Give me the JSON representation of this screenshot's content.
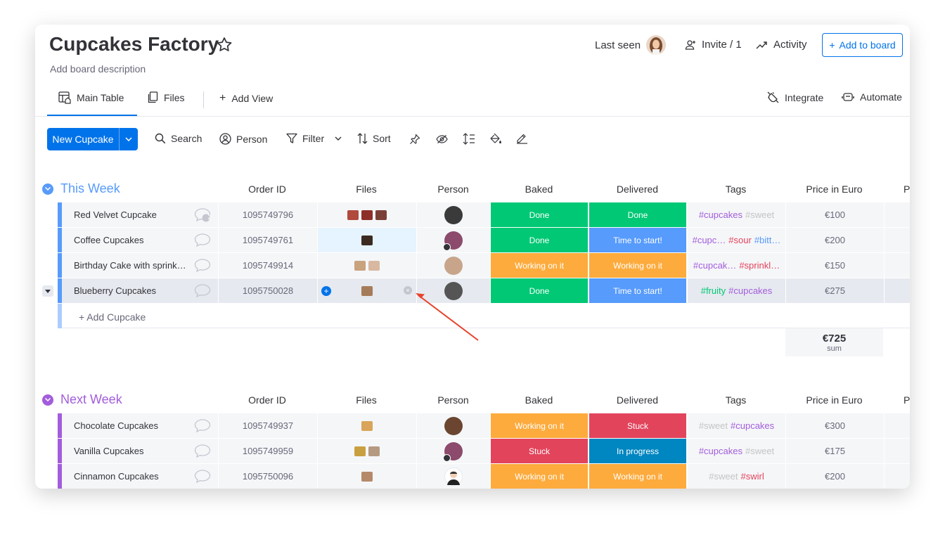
{
  "board": {
    "title": "Cupcakes Factory",
    "description": "Add board description",
    "last_seen_label": "Last seen",
    "invite_label": "Invite / 1",
    "activity_label": "Activity",
    "add_to_board_label": "Add to board"
  },
  "tabs": {
    "main_table": "Main Table",
    "files": "Files",
    "add_view": "Add View",
    "integrate": "Integrate",
    "automate": "Automate"
  },
  "toolbar": {
    "new_item_label": "New Cupcake",
    "search_label": "Search",
    "person_label": "Person",
    "filter_label": "Filter",
    "sort_label": "Sort"
  },
  "columns": {
    "order_id": "Order ID",
    "files": "Files",
    "person": "Person",
    "baked": "Baked",
    "delivered": "Delivered",
    "tags": "Tags",
    "price": "Price in Euro",
    "next": "P"
  },
  "colors": {
    "accent": "#0073ea",
    "this_week": "#579bfc",
    "next_week": "#a25ddc",
    "done": "#00c875",
    "working": "#fdab3d",
    "stuck": "#e2445c",
    "time_to_start": "#579bfc",
    "in_progress": "#0086c0",
    "tag_purple": "#a25ddc",
    "tag_gray": "#c4c4c4",
    "tag_red": "#e2445c",
    "tag_blue": "#579bfc",
    "tag_green": "#00c875"
  },
  "groups": [
    {
      "title": "This Week",
      "add_item_label": "+ Add Cupcake",
      "sum_value": "€725",
      "sum_label": "sum",
      "rows": [
        {
          "name": "Red Velvet Cupcake",
          "chat_count": "2",
          "order_id": "1095749796",
          "baked": "Done",
          "delivered": "Done",
          "tags": [
            "#cupcakes",
            "#sweet"
          ],
          "price": "€100"
        },
        {
          "name": "Coffee Cupcakes",
          "chat_count": "",
          "order_id": "1095749761",
          "baked": "Done",
          "delivered": "Time to start!",
          "tags": [
            "#cupc…",
            "#sour",
            "#bitt…"
          ],
          "price": "€200"
        },
        {
          "name": "Birthday Cake with sprinkl…",
          "chat_count": "",
          "order_id": "1095749914",
          "baked": "Working on it",
          "delivered": "Working on it",
          "tags": [
            "#cupcak…",
            "#sprinkl…"
          ],
          "price": "€150"
        },
        {
          "name": "Blueberry Cupcakes",
          "chat_count": "",
          "order_id": "1095750028",
          "baked": "Done",
          "delivered": "Time to start!",
          "tags": [
            "#fruity",
            "#cupcakes"
          ],
          "price": "€275"
        }
      ]
    },
    {
      "title": "Next Week",
      "rows": [
        {
          "name": "Chocolate Cupcakes",
          "order_id": "1095749937",
          "baked": "Working on it",
          "delivered": "Stuck",
          "tags": [
            "#sweet",
            "#cupcakes"
          ],
          "price": "€300"
        },
        {
          "name": "Vanilla Cupcakes",
          "order_id": "1095749959",
          "baked": "Stuck",
          "delivered": "In progress",
          "tags": [
            "#cupcakes",
            "#sweet"
          ],
          "price": "€175"
        },
        {
          "name": "Cinnamon Cupcakes",
          "order_id": "1095750096",
          "baked": "Working on it",
          "delivered": "Working on it",
          "tags": [
            "#sweet",
            "#swirl"
          ],
          "price": "€200"
        }
      ]
    }
  ]
}
